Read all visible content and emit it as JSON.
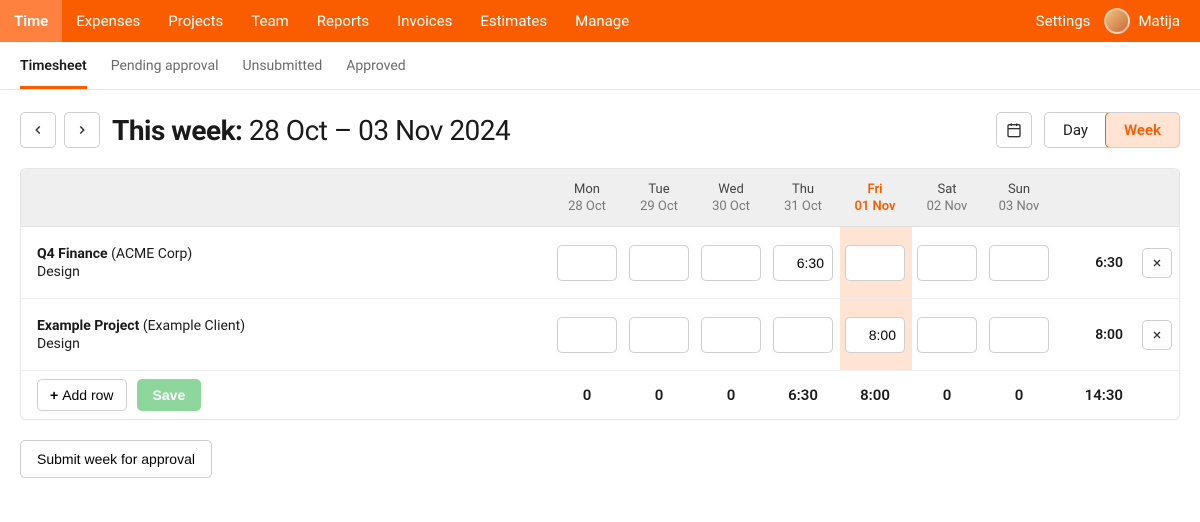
{
  "topnav": {
    "items": [
      {
        "label": "Time",
        "active": true
      },
      {
        "label": "Expenses",
        "active": false
      },
      {
        "label": "Projects",
        "active": false
      },
      {
        "label": "Team",
        "active": false
      },
      {
        "label": "Reports",
        "active": false
      },
      {
        "label": "Invoices",
        "active": false
      },
      {
        "label": "Estimates",
        "active": false
      },
      {
        "label": "Manage",
        "active": false
      }
    ],
    "settings": "Settings",
    "user": "Matija"
  },
  "subnav": {
    "tabs": [
      {
        "label": "Timesheet",
        "active": true
      },
      {
        "label": "Pending approval",
        "active": false
      },
      {
        "label": "Unsubmitted",
        "active": false
      },
      {
        "label": "Approved",
        "active": false
      }
    ]
  },
  "title": {
    "this_week": "This week:",
    "range": "28 Oct – 03 Nov 2024"
  },
  "view": {
    "day": "Day",
    "week": "Week"
  },
  "days": [
    {
      "dow": "Mon",
      "date": "28 Oct",
      "today": false
    },
    {
      "dow": "Tue",
      "date": "29 Oct",
      "today": false
    },
    {
      "dow": "Wed",
      "date": "30 Oct",
      "today": false
    },
    {
      "dow": "Thu",
      "date": "31 Oct",
      "today": false
    },
    {
      "dow": "Fri",
      "date": "01 Nov",
      "today": true
    },
    {
      "dow": "Sat",
      "date": "02 Nov",
      "today": false
    },
    {
      "dow": "Sun",
      "date": "03 Nov",
      "today": false
    }
  ],
  "rows": [
    {
      "project": "Q4 Finance",
      "client": "(ACME Corp)",
      "task": "Design",
      "values": [
        "",
        "",
        "",
        "6:30",
        "",
        "",
        ""
      ],
      "total": "6:30"
    },
    {
      "project": "Example Project",
      "client": "(Example Client)",
      "task": "Design",
      "values": [
        "",
        "",
        "",
        "",
        "8:00",
        "",
        ""
      ],
      "total": "8:00"
    }
  ],
  "column_totals": [
    "0",
    "0",
    "0",
    "6:30",
    "8:00",
    "0",
    "0"
  ],
  "grand_total": "14:30",
  "buttons": {
    "add_row": "Add row",
    "save": "Save",
    "submit": "Submit week for approval"
  }
}
